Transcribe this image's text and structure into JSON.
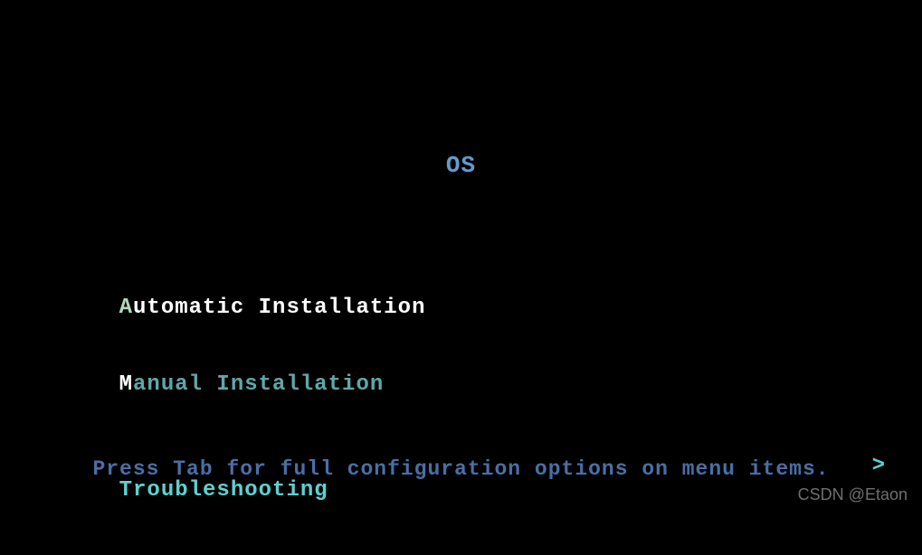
{
  "title": "OS",
  "menu": {
    "items": [
      {
        "hotkey": "A",
        "rest": "utomatic Installation",
        "type": "selected",
        "has_submenu": false
      },
      {
        "hotkey": "M",
        "rest": "anual Installation",
        "type": "normal",
        "has_submenu": false
      },
      {
        "type": "separator"
      },
      {
        "hotkey": "T",
        "rest": "roubleshooting",
        "type": "submenu",
        "has_submenu": true
      }
    ],
    "submenu_indicator": ">"
  },
  "hint": "Press Tab for full configuration options on menu items.",
  "watermark": "CSDN @Etaon"
}
